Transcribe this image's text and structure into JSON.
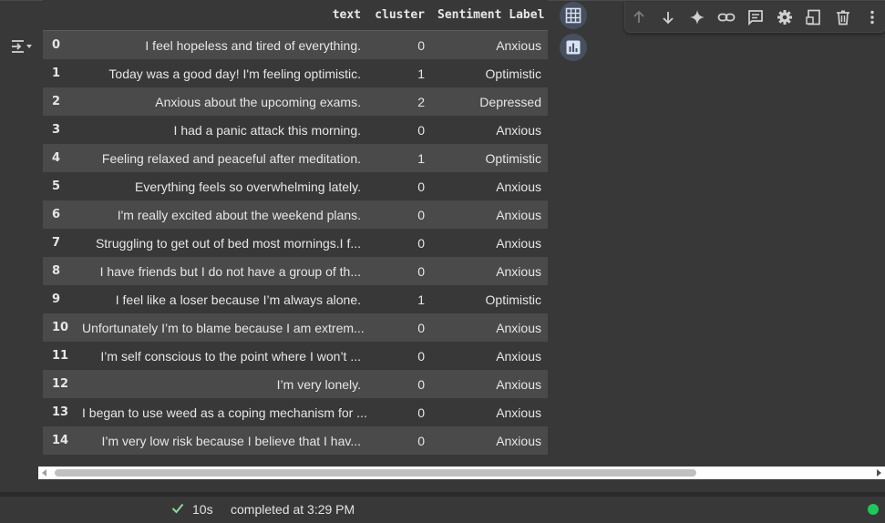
{
  "dataframe": {
    "columns": [
      "",
      "text",
      "cluster",
      "Sentiment Label"
    ],
    "rows": [
      {
        "index": "0",
        "text": "I feel hopeless and tired of everything.",
        "cluster": "0",
        "label": "Anxious"
      },
      {
        "index": "1",
        "text": "Today was a good day! I'm feeling optimistic.",
        "cluster": "1",
        "label": "Optimistic"
      },
      {
        "index": "2",
        "text": "Anxious about the upcoming exams.",
        "cluster": "2",
        "label": "Depressed"
      },
      {
        "index": "3",
        "text": "I had a panic attack this morning.",
        "cluster": "0",
        "label": "Anxious"
      },
      {
        "index": "4",
        "text": "Feeling relaxed and peaceful after meditation.",
        "cluster": "1",
        "label": "Optimistic"
      },
      {
        "index": "5",
        "text": "Everything feels so overwhelming lately.",
        "cluster": "0",
        "label": "Anxious"
      },
      {
        "index": "6",
        "text": "I'm really excited about the weekend plans.",
        "cluster": "0",
        "label": "Anxious"
      },
      {
        "index": "7",
        "text": "Struggling to get out of bed most mornings.I f...",
        "cluster": "0",
        "label": "Anxious"
      },
      {
        "index": "8",
        "text": "I have friends but I do not have a group of th...",
        "cluster": "0",
        "label": "Anxious"
      },
      {
        "index": "9",
        "text": "I feel like a loser because I’m always alone.",
        "cluster": "1",
        "label": "Optimistic"
      },
      {
        "index": "10",
        "text": "Unfortunately I’m to blame because I am extrem...",
        "cluster": "0",
        "label": "Anxious"
      },
      {
        "index": "11",
        "text": "I’m self conscious to the point where I won’t ...",
        "cluster": "0",
        "label": "Anxious"
      },
      {
        "index": "12",
        "text": "I’m very lonely.",
        "cluster": "0",
        "label": "Anxious"
      },
      {
        "index": "13",
        "text": "I began to use weed as a coping mechanism for ...",
        "cluster": "0",
        "label": "Anxious"
      },
      {
        "index": "14",
        "text": "I’m very low risk because I believe that I hav...",
        "cluster": "0",
        "label": "Anxious"
      }
    ]
  },
  "icons": {
    "collapse": "collapse-output-icon",
    "table": "table-view-icon",
    "chart": "bar-chart-icon",
    "toolbar": [
      "arrow-up-icon",
      "arrow-down-icon",
      "sparkle-icon",
      "link-icon",
      "comment-icon",
      "gear-icon",
      "mirror-cell-icon",
      "trash-icon",
      "more-vert-icon"
    ]
  },
  "status": {
    "duration": "10s",
    "message": "completed at 3:29 PM"
  },
  "colors": {
    "background": "#383838",
    "row_stripe": "#4a4a4a",
    "status_ok": "#1ec85a",
    "check": "#8ed99a"
  }
}
